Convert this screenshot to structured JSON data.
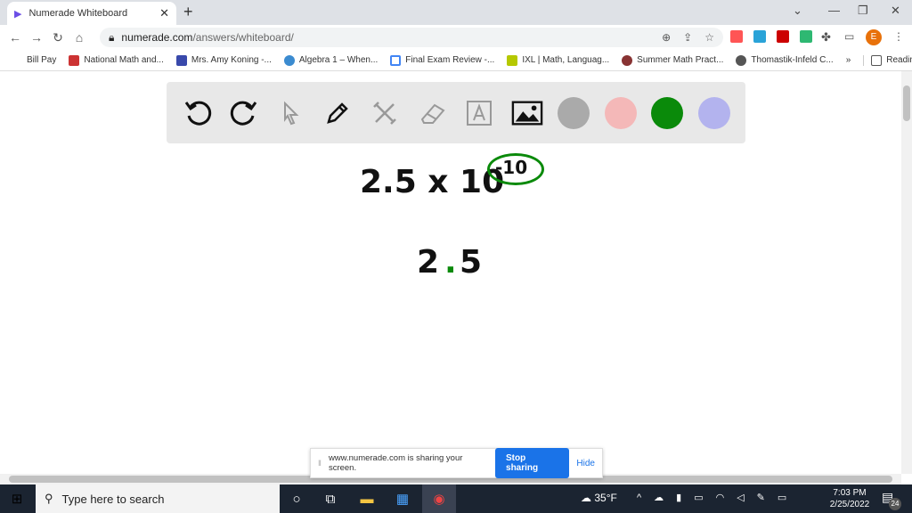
{
  "browser": {
    "tab_title": "Numerade Whiteboard",
    "url_host": "numerade.com",
    "url_path": "/answers/whiteboard/",
    "avatar_letter": "E"
  },
  "bookmarks": [
    "Bill Pay",
    "National Math and...",
    "Mrs. Amy Koning -...",
    "Algebra 1 – When...",
    "Final Exam Review -...",
    "IXL | Math, Languag...",
    "Summer Math Pract...",
    "Thomastik-Infeld C..."
  ],
  "bookmarks_more": "»",
  "reading_list": "Reading list",
  "whiteboard": {
    "line1_base": "2.5 x 10",
    "line1_exponent": "-10",
    "line2_int": "2",
    "line2_dot": ".",
    "line2_frac": "5",
    "colors": [
      "#aaaaaa",
      "#f4b8b8",
      "#0a8a0a",
      "#b3b3ee"
    ]
  },
  "share_bar": {
    "message": "www.numerade.com is sharing your screen.",
    "stop": "Stop sharing",
    "hide": "Hide"
  },
  "taskbar": {
    "search_placeholder": "Type here to search",
    "weather": "35°F",
    "time": "7:03 PM",
    "date": "2/25/2022",
    "notifications": "24"
  }
}
